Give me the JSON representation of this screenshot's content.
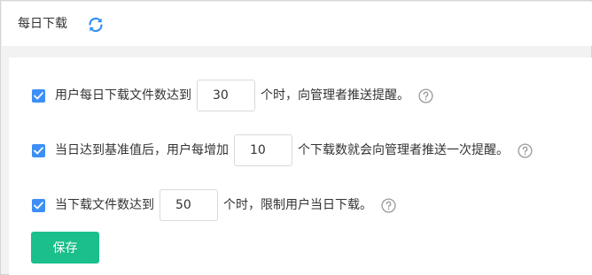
{
  "colors": {
    "accent": "#1bbf8b",
    "checkbox": "#3d8ff7",
    "refresh": "#2f8ff5",
    "help": "#999999"
  },
  "header": {
    "title": "每日下载",
    "refresh_icon": "refresh-icon"
  },
  "rules": [
    {
      "checked": true,
      "prefix": "用户每日下载文件数达到",
      "value": "30",
      "suffix": "个时，向管理者推送提醒。",
      "help_icon": "question-circle-icon"
    },
    {
      "checked": true,
      "prefix": "当日达到基准值后，用户每增加",
      "value": "10",
      "suffix": "个下载数就会向管理者推送一次提醒。",
      "help_icon": "question-circle-icon"
    },
    {
      "checked": true,
      "prefix": "当下载文件数达到",
      "value": "50",
      "suffix": "个时，限制用户当日下载。",
      "help_icon": "question-circle-icon"
    }
  ],
  "actions": {
    "save_label": "保存"
  }
}
